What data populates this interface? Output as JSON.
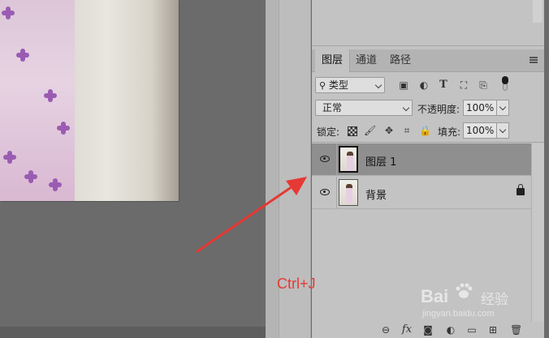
{
  "layers_panel": {
    "tabs": [
      {
        "label": "图层",
        "active": true
      },
      {
        "label": "通道",
        "active": false
      },
      {
        "label": "路径",
        "active": false
      }
    ],
    "filter": {
      "kind_label": "类型"
    },
    "blend_mode": "正常",
    "opacity_label": "不透明度:",
    "opacity_value": "100%",
    "lock_label": "锁定:",
    "fill_label": "填充:",
    "fill_value": "100%",
    "layers": [
      {
        "name": "图层 1",
        "selected": true,
        "visible": true,
        "locked": false
      },
      {
        "name": "背景",
        "selected": false,
        "visible": true,
        "locked": true
      }
    ]
  },
  "annotation": {
    "text": "Ctrl+J",
    "color": "#e53935"
  },
  "watermark": {
    "logo": "Bai  经验",
    "cn": "经验",
    "url": "jingyan.baidu.com"
  },
  "icons": {
    "filter_row": [
      "image-filter-icon",
      "adjustment-filter-icon",
      "type-filter-icon",
      "shape-filter-icon",
      "smart-object-filter-icon"
    ],
    "lock_row": [
      "lock-transparent-pixels-icon",
      "lock-image-pixels-icon",
      "lock-position-icon",
      "lock-artboard-icon",
      "lock-all-icon"
    ],
    "bottom_bar": [
      "link-layers-icon",
      "fx-icon",
      "add-mask-icon",
      "new-adjustment-icon",
      "new-group-icon",
      "new-layer-icon",
      "delete-layer-icon"
    ]
  }
}
